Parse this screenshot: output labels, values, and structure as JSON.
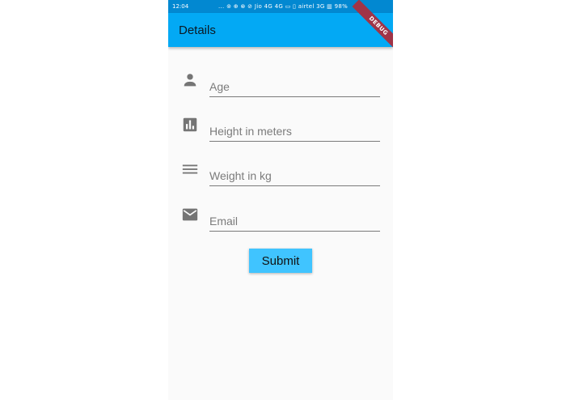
{
  "status_bar": {
    "time": "12:04",
    "icons_text": "...  ⊚ ⊕ ⊗ ⊘  Jio 4G 4G  ▭  ▯ airtel 3G  ▥ 98%"
  },
  "app_bar": {
    "title": "Details",
    "debug_label": "DEBUG"
  },
  "form": {
    "fields": [
      {
        "placeholder": "Age",
        "value": "",
        "icon": "person-icon"
      },
      {
        "placeholder": "Height in meters",
        "value": "",
        "icon": "bar-chart-icon"
      },
      {
        "placeholder": "Weight in kg",
        "value": "",
        "icon": "menu-lines-icon"
      },
      {
        "placeholder": "Email",
        "value": "",
        "icon": "email-icon"
      }
    ],
    "submit_label": "Submit"
  },
  "colors": {
    "status_bar": "#0288d1",
    "app_bar": "#03a9f4",
    "button": "#40c4ff",
    "icon": "#757575",
    "background": "#fafafa"
  }
}
